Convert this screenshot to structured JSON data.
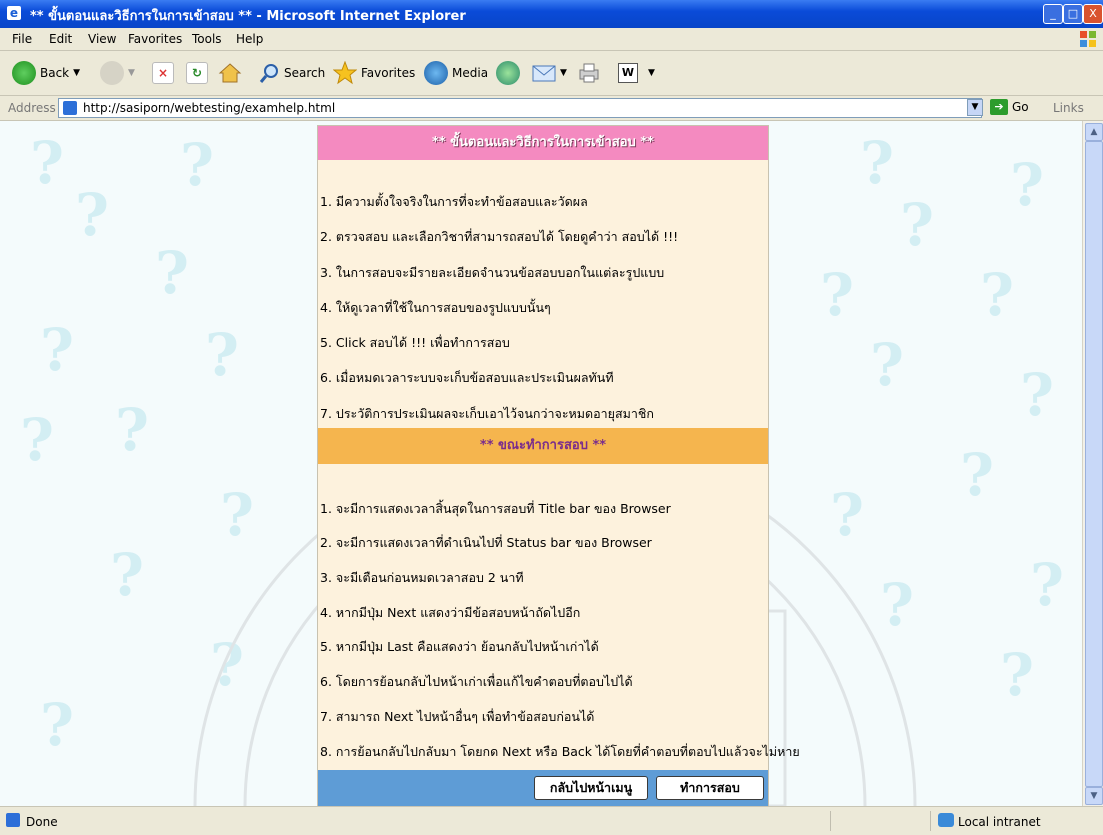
{
  "window": {
    "title": "** ขั้นตอนและวิธีการในการเข้าสอบ ** - Microsoft Internet Explorer",
    "min": "_",
    "max": "□",
    "close": "X"
  },
  "menu": [
    "File",
    "Edit",
    "View",
    "Favorites",
    "Tools",
    "Help"
  ],
  "toolbar": {
    "back": "Back",
    "search": "Search",
    "favorites": "Favorites",
    "media": "Media"
  },
  "address": {
    "label": "Address",
    "url": "http://sasiporn/webtesting/examhelp.html",
    "go": "Go",
    "links": "Links"
  },
  "page": {
    "header1": "** ขั้นตอนและวิธีการในการเข้าสอบ **",
    "steps": [
      "1. มีความตั้งใจจริงในการที่จะทำข้อสอบและวัดผล",
      "2. ตรวจสอบ และเลือกวิชาที่สามารถสอบได้ โดยดูคำว่า สอบได้ !!!",
      "3. ในการสอบจะมีรายละเอียดจำนวนข้อสอบบอกในแต่ละรูปแบบ",
      "4. ให้ดูเวลาที่ใช้ในการสอบของรูปแบบนั้นๆ",
      "5. Click สอบได้ !!! เพื่อทำการสอบ",
      "6. เมื่อหมดเวลาระบบจะเก็บข้อสอบและประเมินผลทันที",
      "7. ประวัติการประเมินผลจะเก็บเอาไว้จนกว่าจะหมดอายุสมาชิก"
    ],
    "header2": "** ขณะทำการสอบ **",
    "during": [
      "1. จะมีการแสดงเวลาสิ้นสุดในการสอบที่ Title bar ของ Browser",
      "2. จะมีการแสดงเวลาที่ดำเนินไปที่ Status bar ของ Browser",
      "3. จะมีเตือนก่อนหมดเวลาสอบ 2 นาที",
      "4. หากมีปุ่ม Next แสดงว่ามีข้อสอบหน้าถัดไปอีก",
      "5. หากมีปุ่ม Last คือแสดงว่า ย้อนกลับไปหน้าเก่าได้",
      "6. โดยการย้อนกลับไปหน้าเก่าเพื่อแก้ไขคำตอบที่ตอบไปได้",
      "7. สามารถ Next ไปหน้าอื่นๆ เพื่อทำข้อสอบก่อนได้",
      "8. การย้อนกลับไปกลับมา โดยกด Next หรือ Back ได้โดยที่คำตอบที่ตอบไปแล้วจะไม่หาย"
    ],
    "btn_menu": "กลับไปหน้าเมนู",
    "btn_exam": "ทำการสอบ"
  },
  "status": {
    "left": "Done",
    "zone": "Local intranet"
  },
  "colors": {
    "header1_bg": "#f48ac0",
    "header2_bg": "#f5b54e",
    "panel_bg": "#fdf2dd",
    "footer_bg": "#5e9cd6",
    "titlebar": "#0a4bd8"
  }
}
